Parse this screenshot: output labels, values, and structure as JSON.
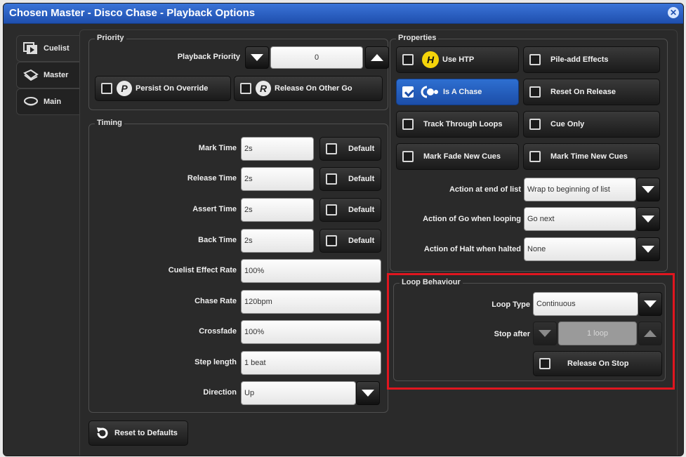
{
  "window": {
    "title": "Chosen Master - Disco Chase - Playback Options"
  },
  "tabs": [
    {
      "label": "Cuelist",
      "icon": "cuelist-icon"
    },
    {
      "label": "Master",
      "icon": "master-icon"
    },
    {
      "label": "Main",
      "icon": "main-icon"
    }
  ],
  "priority": {
    "legend": "Priority",
    "playback_priority_label": "Playback Priority",
    "playback_priority_value": "0",
    "persist_on_override": "Persist On Override",
    "release_on_other_go": "Release On Other Go"
  },
  "timing": {
    "legend": "Timing",
    "default_label": "Default",
    "mark_time_label": "Mark Time",
    "mark_time_value": "2s",
    "release_time_label": "Release Time",
    "release_time_value": "2s",
    "assert_time_label": "Assert Time",
    "assert_time_value": "2s",
    "back_time_label": "Back Time",
    "back_time_value": "2s",
    "cuelist_effect_rate_label": "Cuelist Effect Rate",
    "cuelist_effect_rate_value": "100%",
    "chase_rate_label": "Chase Rate",
    "chase_rate_value": "120bpm",
    "crossfade_label": "Crossfade",
    "crossfade_value": "100%",
    "step_length_label": "Step length",
    "step_length_value": "1 beat",
    "direction_label": "Direction",
    "direction_value": "Up"
  },
  "properties": {
    "legend": "Properties",
    "use_htp": "Use HTP",
    "pile_add_effects": "Pile-add Effects",
    "is_a_chase": "Is A Chase",
    "reset_on_release": "Reset On Release",
    "track_through_loops": "Track Through Loops",
    "cue_only": "Cue Only",
    "mark_fade_new_cues": "Mark Fade New Cues",
    "mark_time_new_cues": "Mark Time New Cues",
    "action_end_label": "Action at end of list",
    "action_end_value": "Wrap to beginning of list",
    "action_go_label": "Action of Go when looping",
    "action_go_value": "Go next",
    "action_halt_label": "Action of Halt when halted",
    "action_halt_value": "None"
  },
  "loop": {
    "legend": "Loop Behaviour",
    "loop_type_label": "Loop Type",
    "loop_type_value": "Continuous",
    "stop_after_label": "Stop after",
    "stop_after_value": "1 loop",
    "release_on_stop": "Release On Stop"
  },
  "reset_defaults": "Reset to Defaults",
  "colors": {
    "accent": "#1f4fae",
    "highlight_frame": "#e0161f",
    "htp_badge": "#f5d40a"
  }
}
